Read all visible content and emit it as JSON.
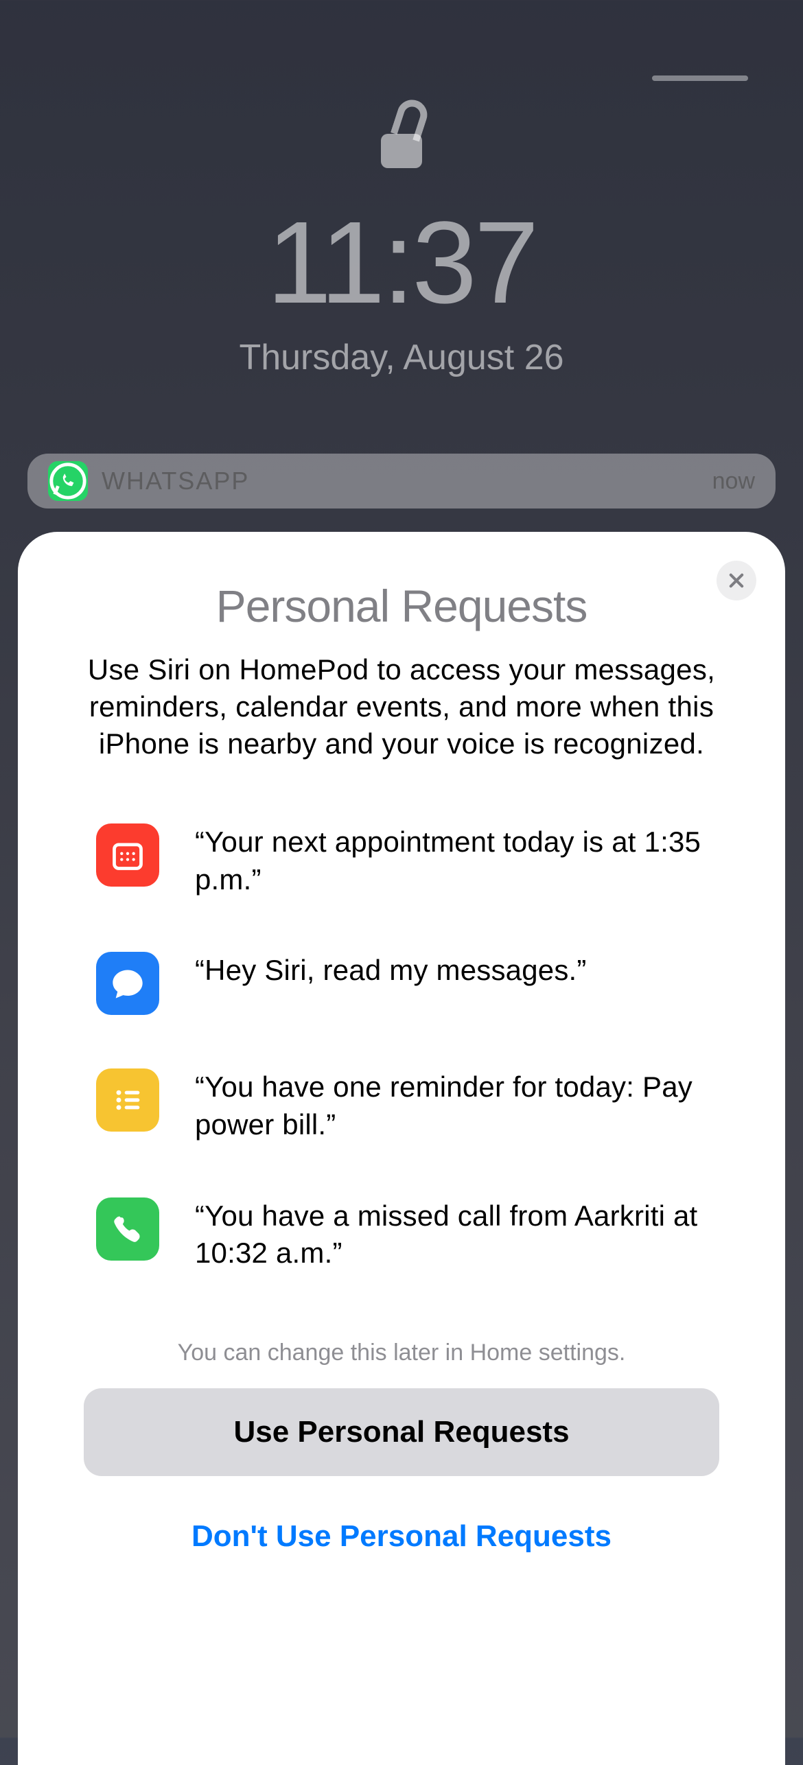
{
  "lockscreen": {
    "time": "11:37",
    "date": "Thursday, August 26"
  },
  "notification": {
    "app": "WHATSAPP",
    "time": "now"
  },
  "sheet": {
    "title": "Personal Requests",
    "description": "Use Siri on HomePod to access your messages, reminders, calendar events, and more when this iPhone is nearby and your voice is recognized.",
    "examples": [
      {
        "icon": "calendar-icon",
        "color": "#fc3c2e",
        "text": "“Your next appointment today is at 1:35 p.m.”"
      },
      {
        "icon": "messages-icon",
        "color": "#1f7ef7",
        "text": "“Hey Siri, read my messages.”"
      },
      {
        "icon": "reminders-icon",
        "color": "#f7c431",
        "text": "“You have one reminder for today: Pay power bill.”"
      },
      {
        "icon": "phone-icon",
        "color": "#34c759",
        "text": "“You have a missed call from Aarkriti at 10:32 a.m.”"
      }
    ],
    "footnote": "You can change this later in Home settings.",
    "primary": "Use Personal Requests",
    "secondary": "Don't Use Personal Requests"
  }
}
